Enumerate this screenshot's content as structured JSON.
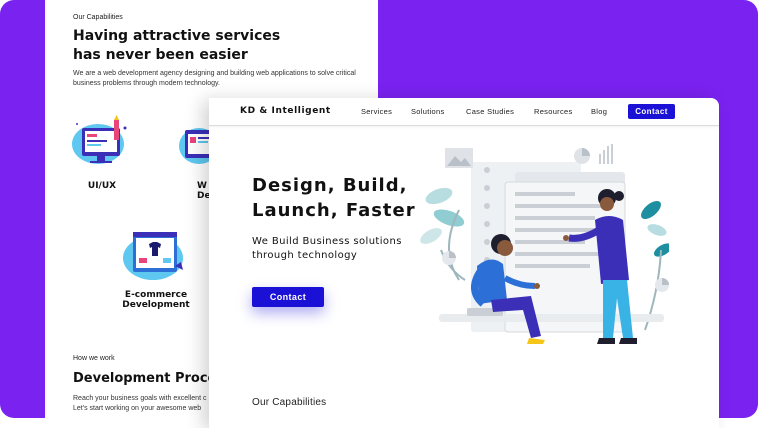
{
  "back_page": {
    "eyebrow": "Our Capabilities",
    "heading_line1": "Having attractive services",
    "heading_line2": "has never been easier",
    "description": "We are a web development agency designing and building web applications to solve critical business problems through modern technology.",
    "capabilities": [
      {
        "label": "UI/UX",
        "icon": "uiux-illustration-icon"
      },
      {
        "label": "W",
        "label2": "De",
        "icon": "web-development-illustration-icon"
      },
      {
        "label": "E-commerce",
        "label2": "Development",
        "icon": "ecommerce-illustration-icon"
      }
    ],
    "process_eyebrow": "How we work",
    "process_heading": "Development Proces",
    "process_desc_line1": "Reach your business goals with excellent c",
    "process_desc_line2": "Let's start working on your awesome web"
  },
  "front_page": {
    "brand": "KD & Intelligent",
    "nav": [
      "Services",
      "Solutions",
      "Case Studies",
      "Resources",
      "Blog"
    ],
    "nav_contact": "Contact",
    "hero": {
      "title_line1": "Design, Build,",
      "title_line2": "Launch, Faster",
      "subtitle_line1": "We Build Business solutions",
      "subtitle_line2": "through technology",
      "cta": "Contact"
    },
    "capabilities_label": "Our Capabilities"
  },
  "colors": {
    "background": "#7a22f0",
    "accent": "#1a10d6",
    "illustration_blue": "#2c6fd6",
    "illustration_purple": "#3b2fb8",
    "illustration_cyan": "#39b3e6",
    "illustration_yellow": "#f5c518"
  }
}
